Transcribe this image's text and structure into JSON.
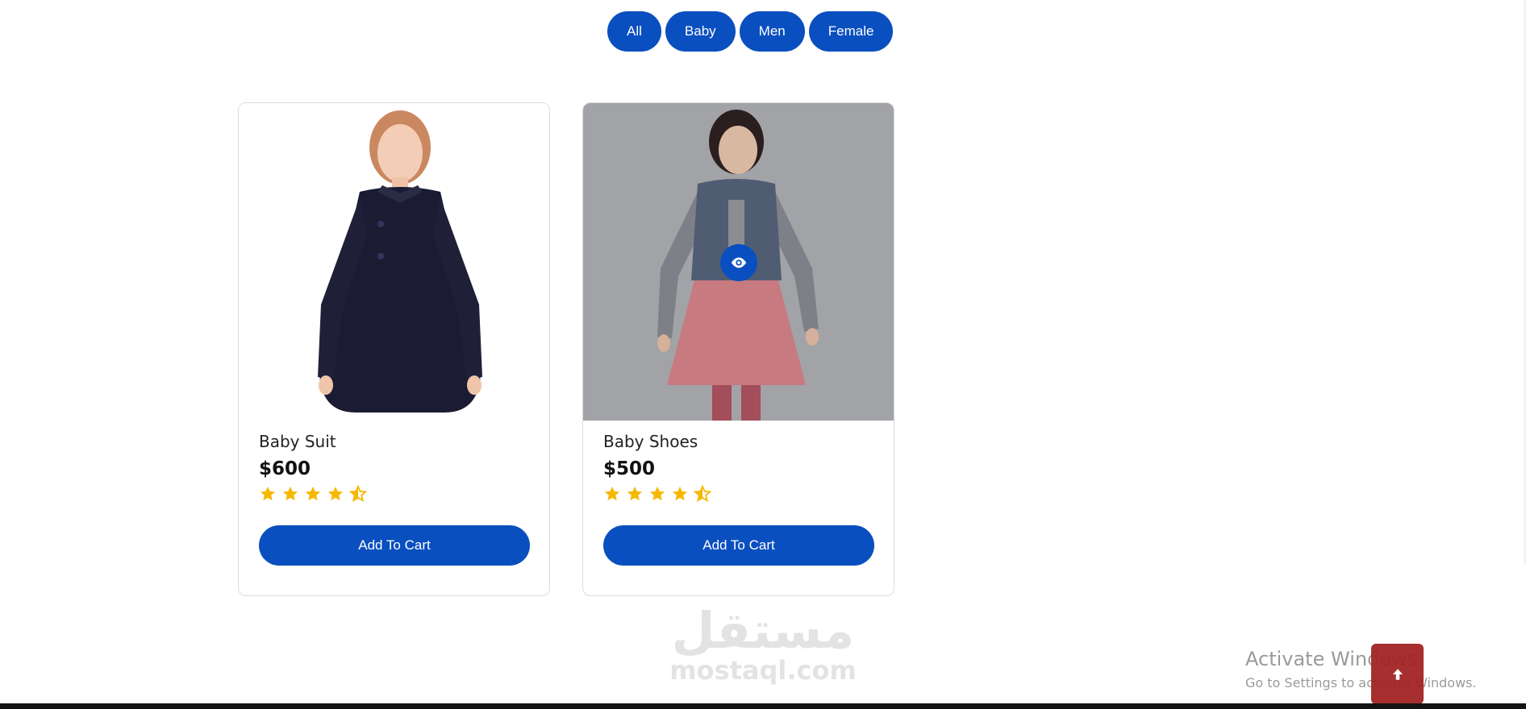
{
  "filters": [
    "All",
    "Baby",
    "Men",
    "Female"
  ],
  "products": [
    {
      "name": "Baby Suit",
      "price": "$600",
      "rating": 4.5,
      "button": "Add To Cart",
      "image": "girl-in-navy-coat"
    },
    {
      "name": "Baby Shoes",
      "price": "$500",
      "rating": 4.5,
      "button": "Add To Cart",
      "image": "toddler-in-vest-and-pink-skirt"
    }
  ],
  "watermark": {
    "arabic": "مستقل",
    "latin": "mostaql.com"
  },
  "activate_windows": {
    "title": "Activate Windows",
    "subtitle": "Go to Settings to activate Windows."
  },
  "colors": {
    "primary": "#0a4fbf",
    "star": "#f6b800",
    "scroll_top": "#a32424",
    "overlay": "#a2a3a7"
  },
  "icons": {
    "quick_view": "eye-icon",
    "scroll_top": "arrow-up-icon",
    "rating": "star-icon"
  }
}
